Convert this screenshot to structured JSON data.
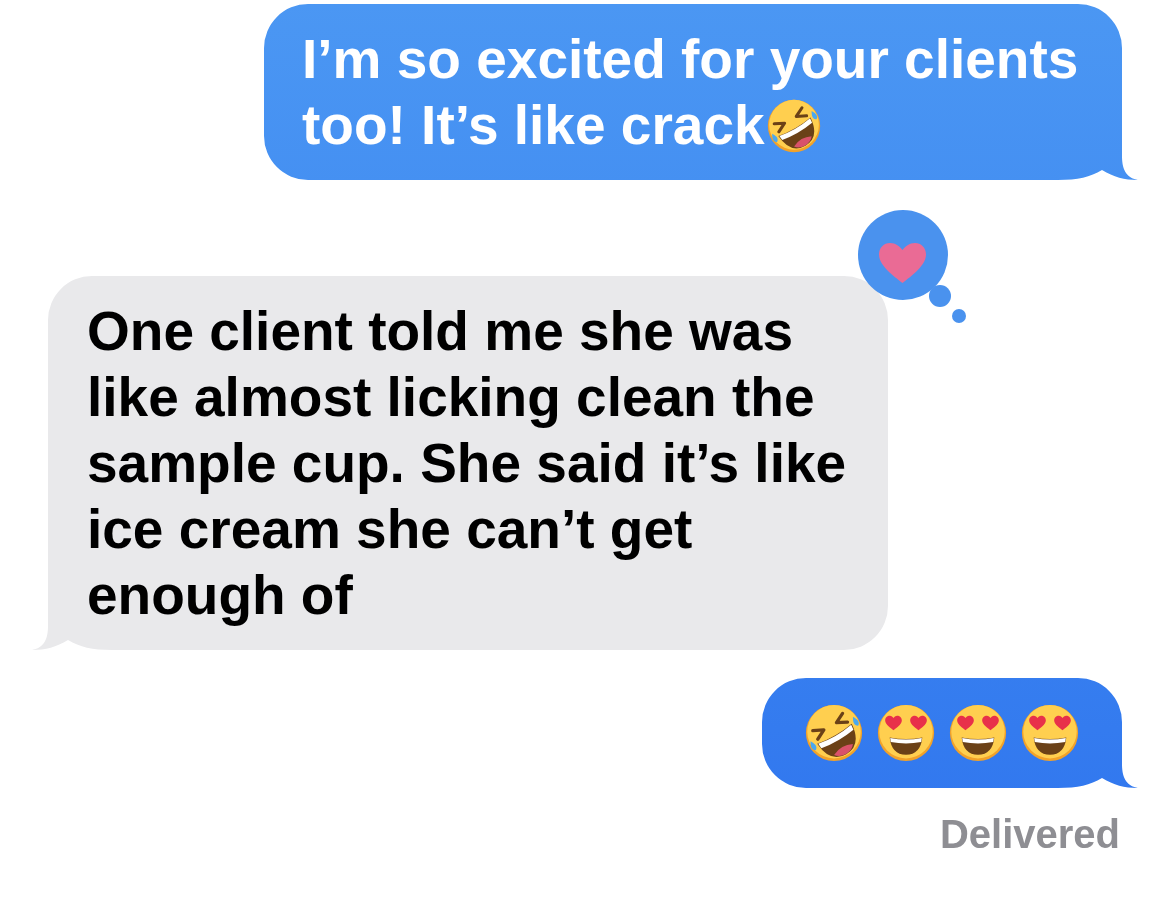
{
  "messages": [
    {
      "kind": "sent",
      "text": "I’m so excited for your clients too! It’s like crack",
      "emojis": [
        {
          "kind": "rofl"
        }
      ]
    },
    {
      "kind": "received",
      "text": "One client told me she was like almost licking clean the sample cup. She said it’s like ice cream she can’t get enough of",
      "reaction": {
        "kind": "heart"
      }
    },
    {
      "kind": "sent",
      "emojis": [
        {
          "kind": "rofl"
        },
        {
          "kind": "heart_eyes"
        },
        {
          "kind": "heart_eyes"
        },
        {
          "kind": "heart_eyes"
        }
      ]
    }
  ],
  "status": "Delivered"
}
